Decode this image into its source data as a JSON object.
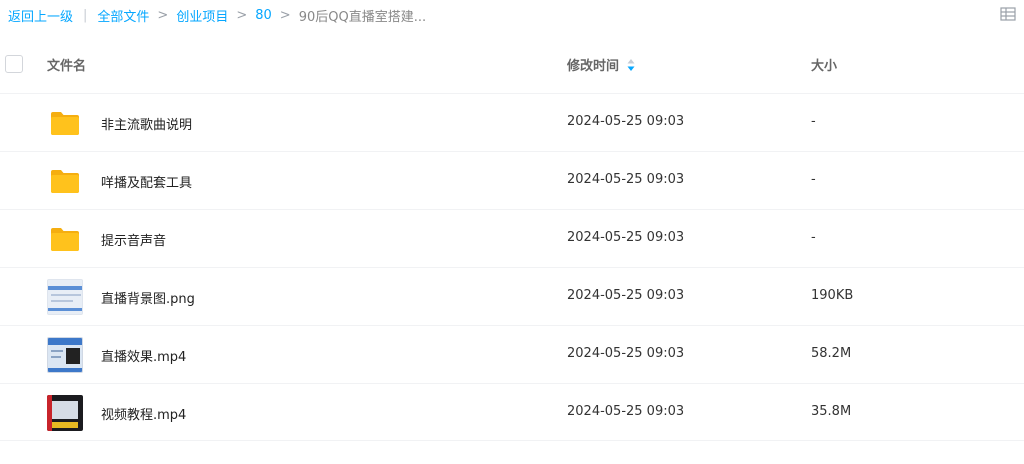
{
  "breadcrumb": {
    "back": "返回上一级",
    "divider": "|",
    "separator": ">",
    "items": [
      "全部文件",
      "创业项目",
      "80"
    ],
    "current": "90后QQ直播室搭建..."
  },
  "header": {
    "name": "文件名",
    "time": "修改时间",
    "size": "大小"
  },
  "files": [
    {
      "name": "非主流歌曲说明",
      "time": "2024-05-25 09:03",
      "size": "-",
      "icon": "folder-icon"
    },
    {
      "name": "咩播及配套工具",
      "time": "2024-05-25 09:03",
      "size": "-",
      "icon": "folder-icon"
    },
    {
      "name": "提示音声音",
      "time": "2024-05-25 09:03",
      "size": "-",
      "icon": "folder-icon"
    },
    {
      "name": "直播背景图.png",
      "time": "2024-05-25 09:03",
      "size": "190KB",
      "icon": "image-thumbnail"
    },
    {
      "name": "直播效果.mp4",
      "time": "2024-05-25 09:03",
      "size": "58.2M",
      "icon": "video-thumbnail"
    },
    {
      "name": "视频教程.mp4",
      "time": "2024-05-25 09:03",
      "size": "35.8M",
      "icon": "video-thumbnail"
    }
  ],
  "colors": {
    "link": "#06a7ff",
    "sort_active": "#06a7ff",
    "folder": "#ffc21c"
  }
}
